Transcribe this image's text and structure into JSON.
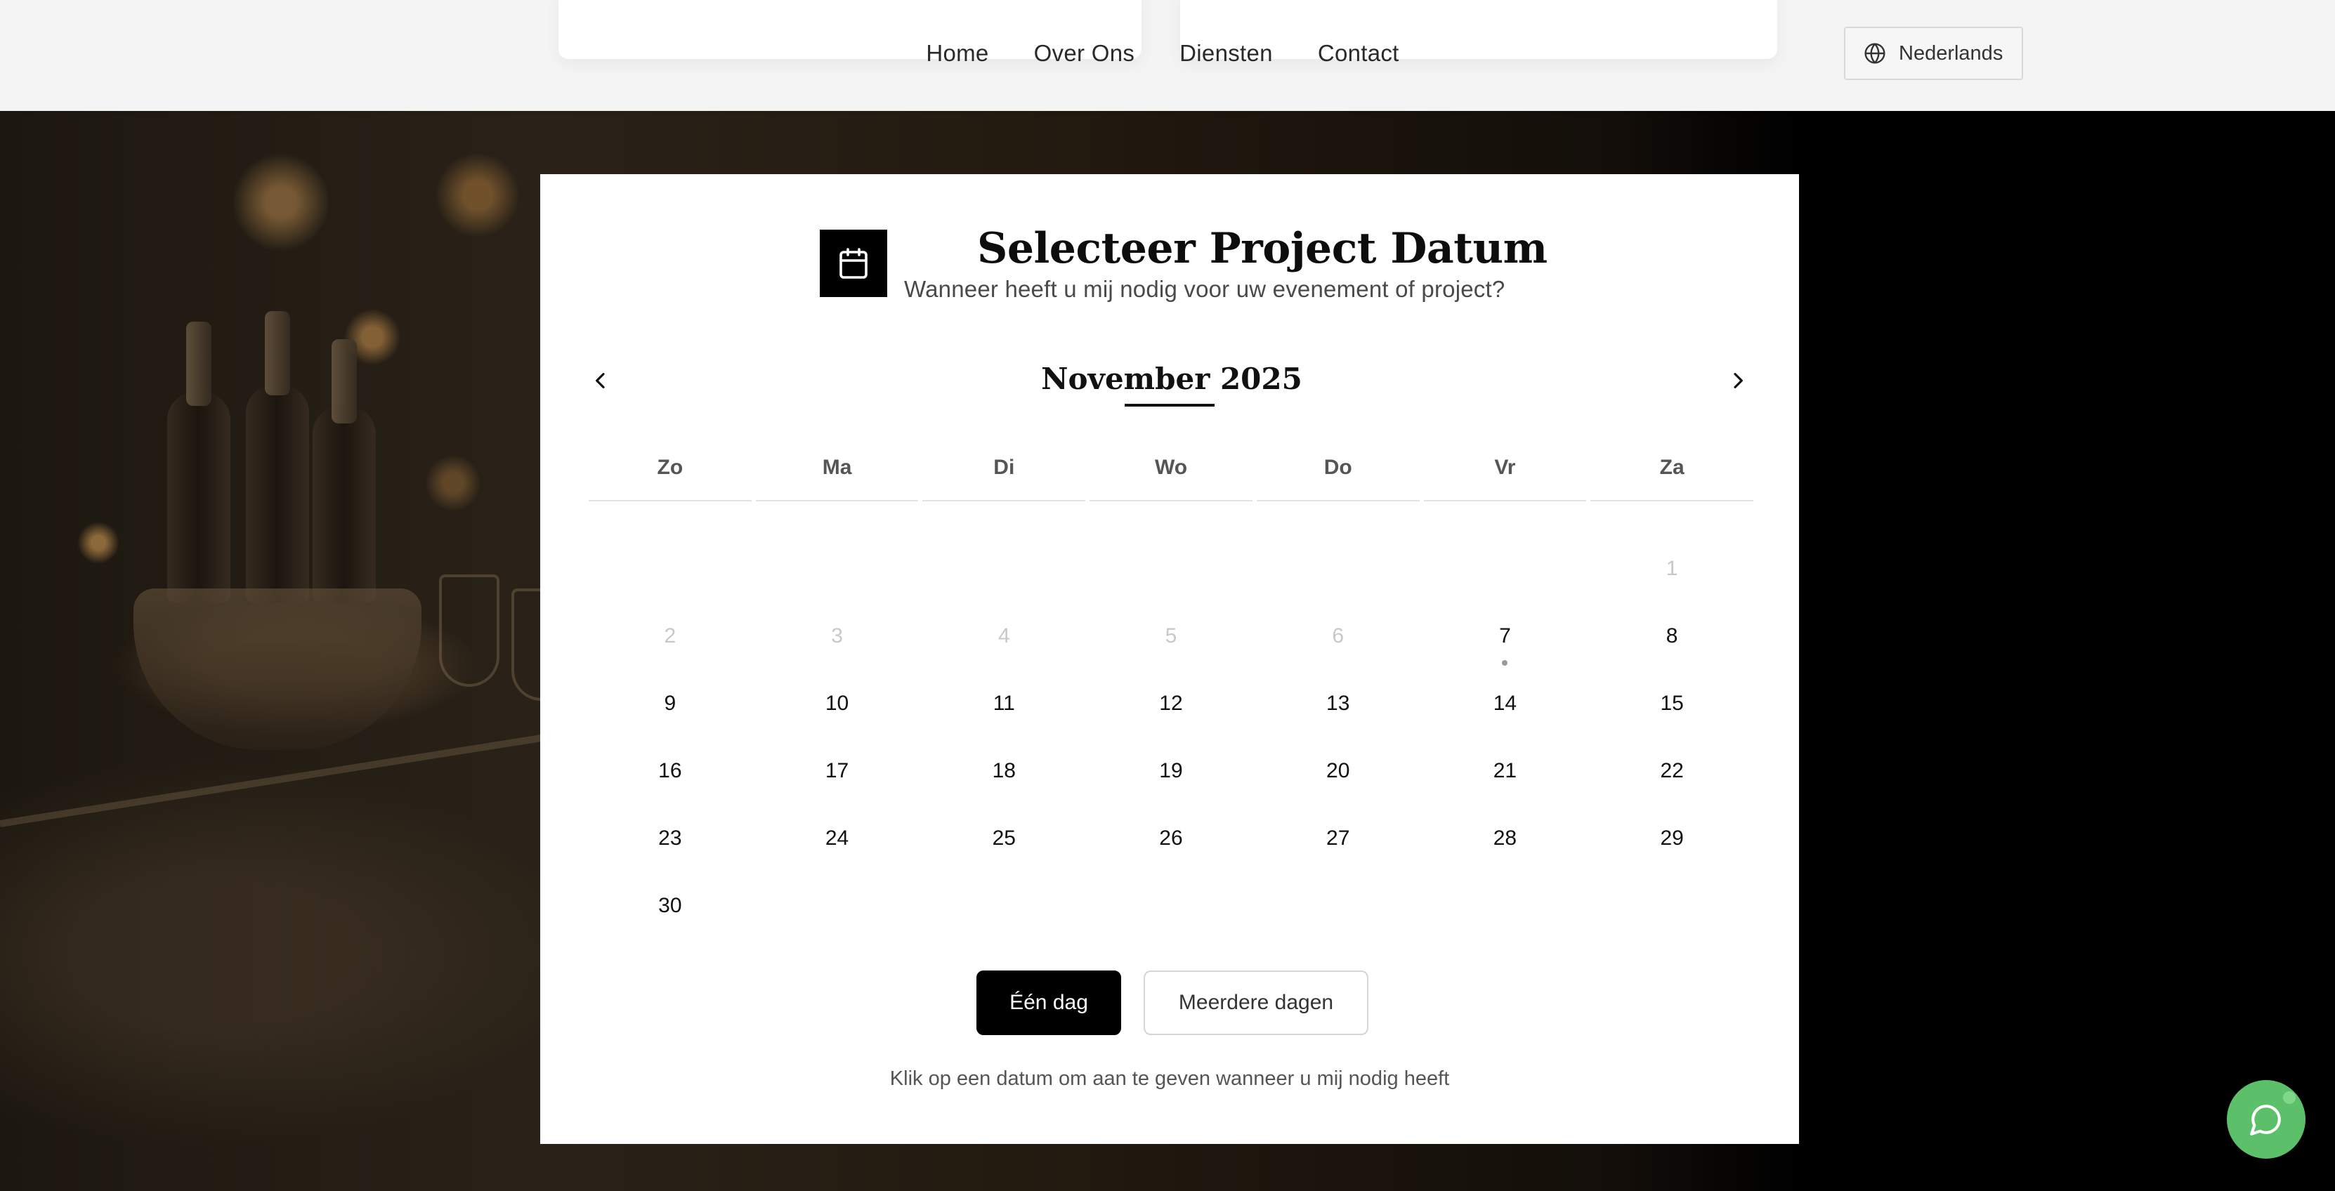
{
  "nav": {
    "items": [
      "Home",
      "Over Ons",
      "Diensten",
      "Contact"
    ],
    "language_label": "Nederlands",
    "language_icon": "globe-icon"
  },
  "modal": {
    "icon": "calendar-icon",
    "title": "Selecteer Project Datum",
    "subtitle": "Wanneer heeft u mij nodig voor uw evenement of project?",
    "month_label": "November 2025",
    "prev_icon": "chevron-left-icon",
    "next_icon": "chevron-right-icon",
    "weekdays": [
      "Zo",
      "Ma",
      "Di",
      "Wo",
      "Do",
      "Vr",
      "Za"
    ],
    "days": [
      {
        "label": "",
        "state": "empty"
      },
      {
        "label": "",
        "state": "empty"
      },
      {
        "label": "",
        "state": "empty"
      },
      {
        "label": "",
        "state": "empty"
      },
      {
        "label": "",
        "state": "empty"
      },
      {
        "label": "",
        "state": "empty"
      },
      {
        "label": "1",
        "state": "disabled"
      },
      {
        "label": "2",
        "state": "disabled"
      },
      {
        "label": "3",
        "state": "disabled"
      },
      {
        "label": "4",
        "state": "disabled"
      },
      {
        "label": "5",
        "state": "disabled"
      },
      {
        "label": "6",
        "state": "disabled"
      },
      {
        "label": "7",
        "state": "today"
      },
      {
        "label": "8",
        "state": "available"
      },
      {
        "label": "9",
        "state": "available"
      },
      {
        "label": "10",
        "state": "available"
      },
      {
        "label": "11",
        "state": "available"
      },
      {
        "label": "12",
        "state": "available"
      },
      {
        "label": "13",
        "state": "available"
      },
      {
        "label": "14",
        "state": "available"
      },
      {
        "label": "15",
        "state": "available"
      },
      {
        "label": "16",
        "state": "available"
      },
      {
        "label": "17",
        "state": "available"
      },
      {
        "label": "18",
        "state": "available"
      },
      {
        "label": "19",
        "state": "available"
      },
      {
        "label": "20",
        "state": "available"
      },
      {
        "label": "21",
        "state": "available"
      },
      {
        "label": "22",
        "state": "available"
      },
      {
        "label": "23",
        "state": "available"
      },
      {
        "label": "24",
        "state": "available"
      },
      {
        "label": "25",
        "state": "available"
      },
      {
        "label": "26",
        "state": "available"
      },
      {
        "label": "27",
        "state": "available"
      },
      {
        "label": "28",
        "state": "available"
      },
      {
        "label": "29",
        "state": "available"
      },
      {
        "label": "30",
        "state": "available"
      }
    ],
    "mode_single": "Één dag",
    "mode_multi": "Meerdere dagen",
    "selected_mode": "single",
    "hint": "Klik op een datum om aan te geven wanneer u mij nodig heeft"
  },
  "chat": {
    "icon": "chat-bubble-icon",
    "color": "#5cc06b"
  },
  "colors": {
    "accent": "#000000",
    "muted_day": "#c8c8c8",
    "header_bg": "#f4f4f4"
  }
}
